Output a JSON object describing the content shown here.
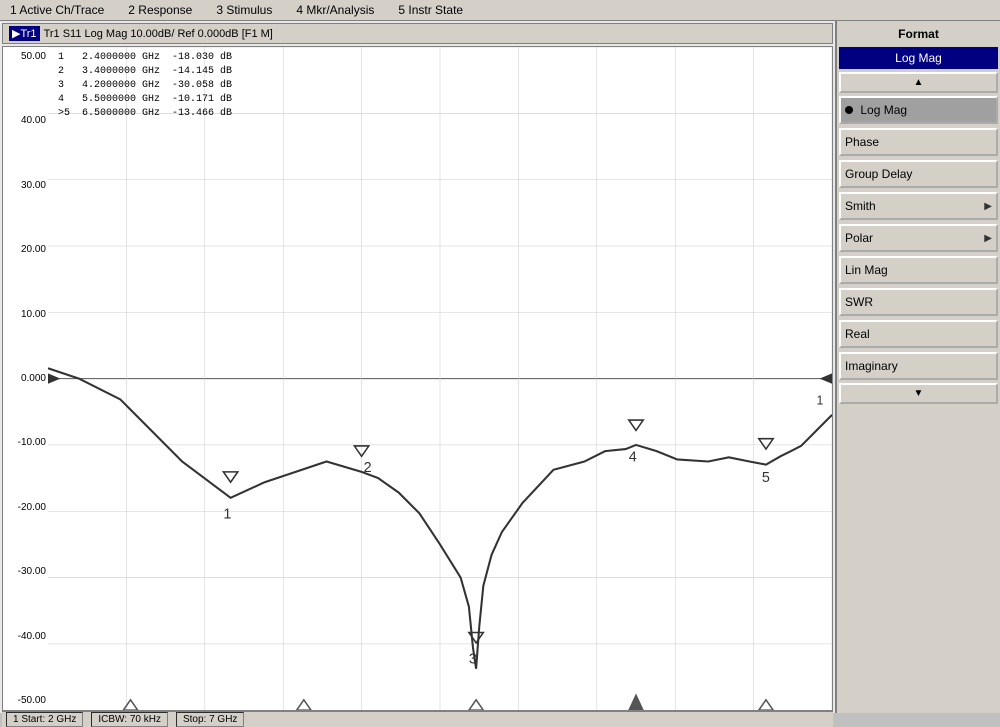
{
  "menubar": {
    "items": [
      "1 Active Ch/Trace",
      "2 Response",
      "3 Stimulus",
      "4 Mkr/Analysis",
      "5 Instr State"
    ]
  },
  "chart": {
    "title": "Tr1 S11 Log Mag 10.00dB/ Ref 0.000dB [F1 M]",
    "y_labels": [
      "50.00",
      "40.00",
      "30.00",
      "20.00",
      "10.00",
      "0.000",
      "-10.00",
      "-20.00",
      "-30.00",
      "-40.00",
      "-50.00"
    ],
    "markers": [
      {
        "num": "1",
        "freq": "2.4000000",
        "unit": "GHz",
        "value": "-18.030",
        "db": "dB"
      },
      {
        "num": "2",
        "freq": "3.4000000",
        "unit": "GHz",
        "value": "-14.145",
        "db": "dB"
      },
      {
        "num": "3",
        "freq": "4.2000000",
        "unit": "GHz",
        "value": "-30.058",
        "db": "dB"
      },
      {
        "num": "4",
        "freq": "5.5000000",
        "unit": "GHz",
        "value": "-10.171",
        "db": "dB"
      },
      {
        "num": ">5",
        "freq": "6.5000000",
        "unit": "GHz",
        "value": "-13.466",
        "db": "dB"
      }
    ]
  },
  "format_panel": {
    "header": "Format",
    "selected": "Log Mag",
    "buttons": [
      {
        "label": "Log Mag",
        "active": true,
        "has_arrow": false
      },
      {
        "label": "Phase",
        "active": false,
        "has_arrow": false
      },
      {
        "label": "Group Delay",
        "active": false,
        "has_arrow": false
      },
      {
        "label": "Smith",
        "active": false,
        "has_arrow": true
      },
      {
        "label": "Polar",
        "active": false,
        "has_arrow": true
      },
      {
        "label": "Lin Mag",
        "active": false,
        "has_arrow": false
      },
      {
        "label": "SWR",
        "active": false,
        "has_arrow": false
      },
      {
        "label": "Real",
        "active": false,
        "has_arrow": false
      },
      {
        "label": "Imaginary",
        "active": false,
        "has_arrow": false
      }
    ]
  },
  "status_bar": {
    "start": "1 Start: 2 GHz",
    "center": "ICBW: 70 kHz",
    "stop": "Stop: 7 GHz"
  }
}
